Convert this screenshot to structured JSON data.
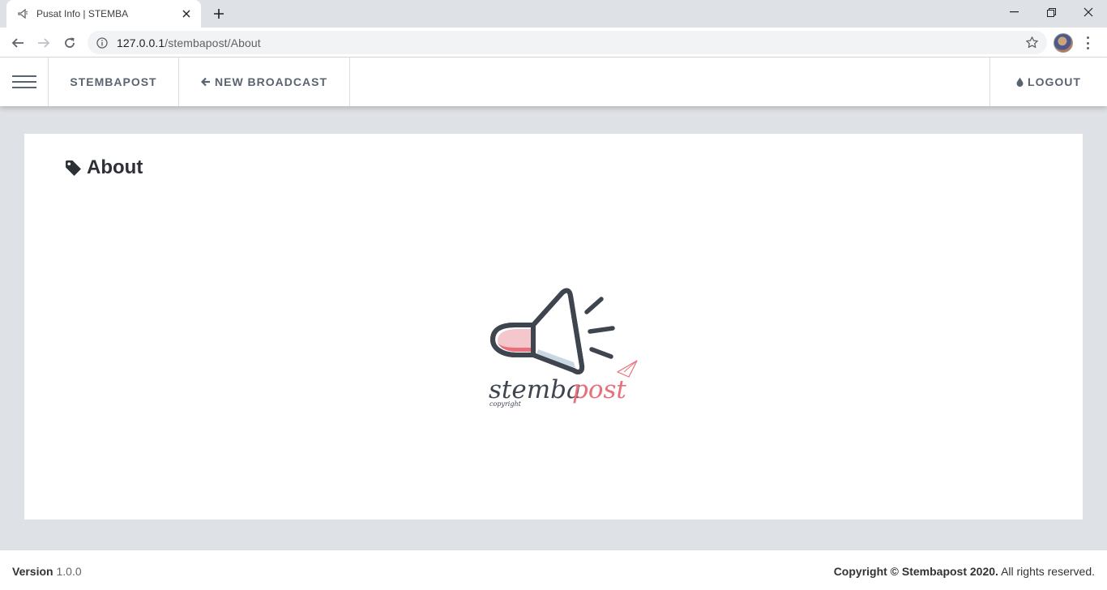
{
  "browser": {
    "tab_title": "Pusat Info | STEMBA",
    "url_host": "127.0.0.1",
    "url_path": "/stembapost/About"
  },
  "navbar": {
    "brand": "STEMBAPOST",
    "new_broadcast": "NEW BROADCAST",
    "logout": "LOGOUT"
  },
  "page": {
    "title": "About"
  },
  "logo": {
    "word1": "stemba",
    "word2": "post",
    "subtext": "copyright"
  },
  "footer": {
    "version_label": "Version",
    "version_value": "1.0.0",
    "copyright": "Copyright © Stembapost 2020.",
    "rights": "All rights reserved."
  },
  "colors": {
    "accent": "#e8707a",
    "dark": "#3e454f",
    "nav_text": "#5a6470"
  }
}
